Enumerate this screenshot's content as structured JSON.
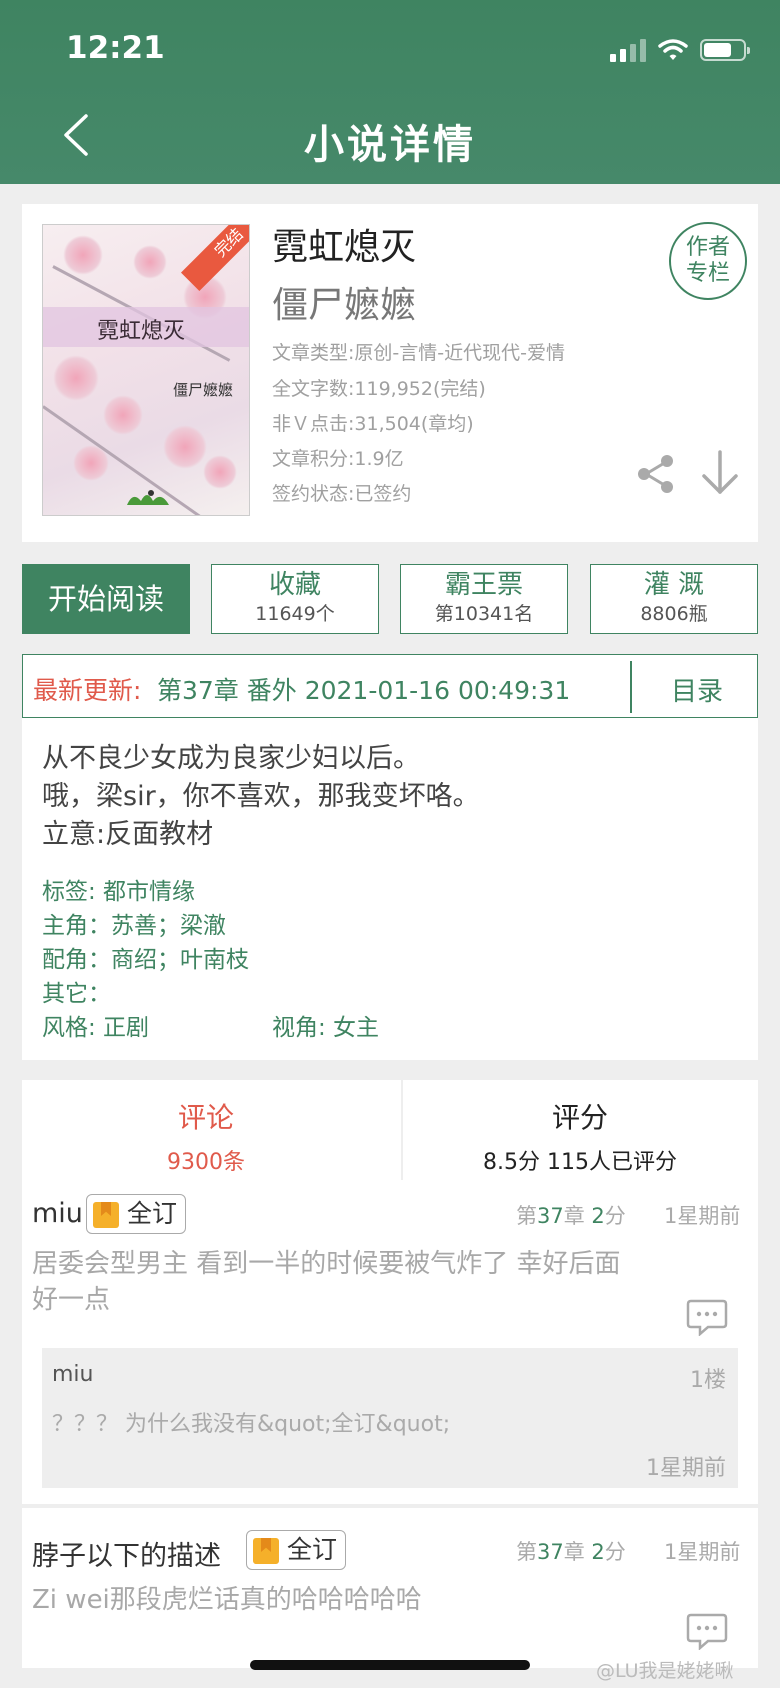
{
  "status": {
    "time": "12:21"
  },
  "header": {
    "title": "小说详情"
  },
  "book": {
    "title": "霓虹熄灭",
    "author": "僵尸嬷嬷",
    "cover_title": "霓虹熄灭",
    "cover_author": "僵尸嬷嬷",
    "cover_ribbon": "完结",
    "meta": [
      "文章类型:原创-言情-近代现代-爱情",
      "全文字数:119,952(完结)",
      "非Ｖ点击:31,504(章均)",
      "文章积分:1.9亿",
      "签约状态:已签约"
    ],
    "author_column_line1": "作者",
    "author_column_line2": "专栏"
  },
  "actions": {
    "read": "开始阅读",
    "stats": [
      {
        "label": "收藏",
        "value": "11649个"
      },
      {
        "label": "霸王票",
        "value": "第10341名"
      },
      {
        "label": "灌 溉",
        "value": "8806瓶"
      }
    ]
  },
  "update": {
    "label": "最新更新:",
    "text": "第37章 番外 2021-01-16 00:49:31",
    "toc": "目录"
  },
  "description": {
    "lines": [
      "从不良少女成为良家少妇以后。",
      "哦，梁sir，你不喜欢，那我变坏咯。",
      "立意:反面教材"
    ],
    "tags": "标签:  都市情缘",
    "protagonist": "主角：苏善；梁澈",
    "supporting": "配角：商绍；叶南枝",
    "other": "其它：",
    "style": "风格:  正剧",
    "perspective": "视角: 女主"
  },
  "reviews": {
    "tab_comments": "评论",
    "tab_comments_count": "9300条",
    "tab_rating": "评分",
    "tab_rating_text": "8.5分 115人已评分",
    "items": [
      {
        "user": "miu",
        "badge": "全订",
        "chapter_prefix": "第",
        "chapter": "37",
        "chapter_mid": "章",
        "score": "2",
        "score_suffix": "分",
        "time": "1星期前",
        "text_line1": "居委会型男主 看到一半的时候要被气炸了 幸好后面",
        "text_line2": "好一点",
        "reply": {
          "user": "miu",
          "floor": "1楼",
          "text": "？？？ 为什么我没有&quot;全订&quot;",
          "time": "1星期前"
        }
      },
      {
        "user": "脖子以下的描述",
        "badge": "全订",
        "chapter_prefix": "第",
        "chapter": "37",
        "chapter_mid": "章",
        "score": "2",
        "score_suffix": "分",
        "time": "1星期前",
        "text_line1": "Zi wei那段虎烂话真的哈哈哈哈哈"
      }
    ]
  },
  "watermark": "@LU我是姥姥啾",
  "colors": {
    "brand": "#3f8461",
    "accent": "#e05a4b"
  }
}
